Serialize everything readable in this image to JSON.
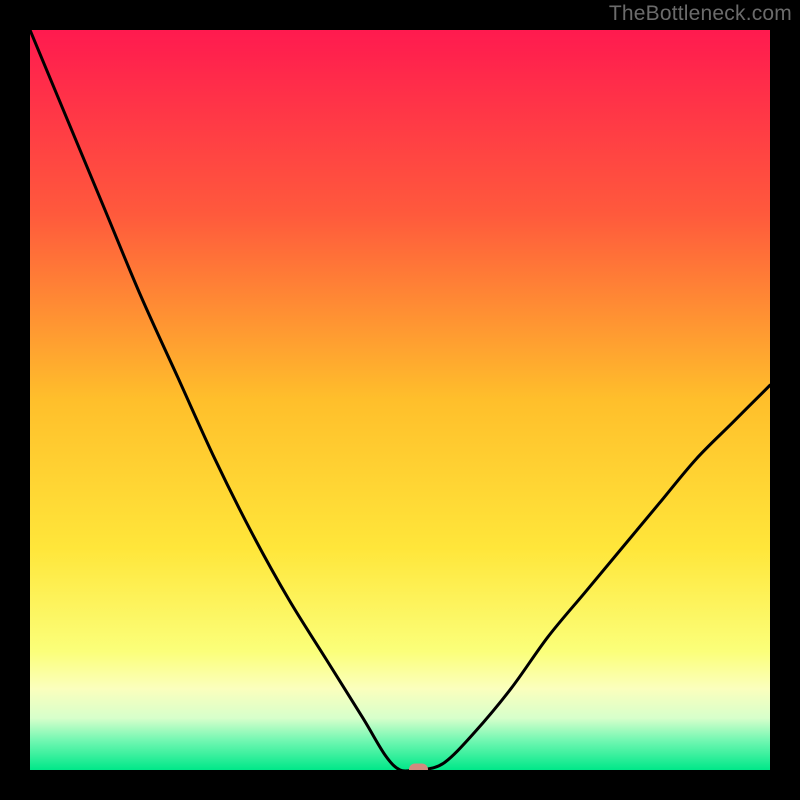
{
  "watermark": "TheBottleneck.com",
  "chart_data": {
    "type": "line",
    "title": "",
    "xlabel": "",
    "ylabel": "",
    "xlim": [
      0,
      100
    ],
    "ylim": [
      0,
      100
    ],
    "grid": false,
    "legend": false,
    "series": [
      {
        "name": "bottleneck-curve",
        "x": [
          0,
          5,
          10,
          15,
          20,
          25,
          30,
          35,
          40,
          45,
          48,
          50,
          52,
          53,
          56,
          60,
          65,
          70,
          75,
          80,
          85,
          90,
          95,
          100
        ],
        "y": [
          100,
          88,
          76,
          64,
          53,
          42,
          32,
          23,
          15,
          7,
          2,
          0,
          0,
          0,
          1,
          5,
          11,
          18,
          24,
          30,
          36,
          42,
          47,
          52
        ]
      }
    ],
    "markers": [
      {
        "name": "optimal-point",
        "x": 52.5,
        "y": 0,
        "color": "#d38b7f"
      }
    ],
    "background_gradient": {
      "stops": [
        {
          "offset": 0.0,
          "color": "#ff1a4f"
        },
        {
          "offset": 0.25,
          "color": "#ff5a3c"
        },
        {
          "offset": 0.5,
          "color": "#ffbf2b"
        },
        {
          "offset": 0.7,
          "color": "#ffe63a"
        },
        {
          "offset": 0.84,
          "color": "#fbff7a"
        },
        {
          "offset": 0.89,
          "color": "#fbffbd"
        },
        {
          "offset": 0.93,
          "color": "#d7ffcb"
        },
        {
          "offset": 0.96,
          "color": "#72f7b2"
        },
        {
          "offset": 1.0,
          "color": "#00e889"
        }
      ]
    }
  }
}
